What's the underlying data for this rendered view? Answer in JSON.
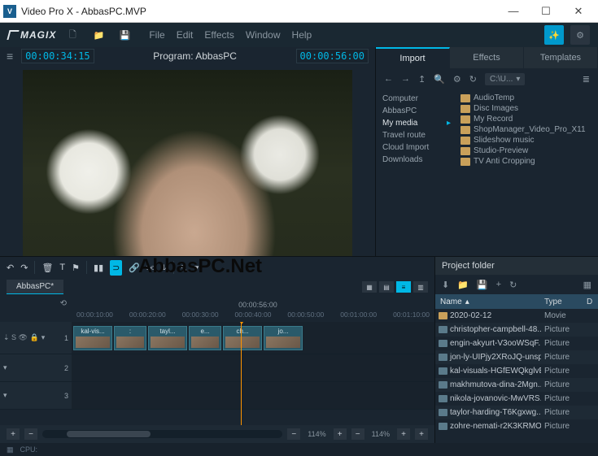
{
  "window": {
    "title": "Video Pro X - AbbasPC.MVP",
    "min": "—",
    "max": "☐",
    "close": "✕"
  },
  "brand": "MAGIX",
  "menu": {
    "file": "File",
    "edit": "Edit",
    "effects": "Effects",
    "window": "Window",
    "help": "Help"
  },
  "preview": {
    "tc_in": "00:00:34:15",
    "program": "Program: AbbasPC",
    "tc_out": "00:00:56:00",
    "ruler_tc": "56:00"
  },
  "import_tabs": {
    "import": "Import",
    "effects": "Effects",
    "templates": "Templates"
  },
  "browser": {
    "path": "C:\\U...",
    "refresh": "↻",
    "tree": {
      "computer": "Computer",
      "abbaspc": "AbbasPC",
      "mymedia": "My media",
      "travel": "Travel route",
      "cloud": "Cloud Import",
      "downloads": "Downloads"
    },
    "folders": {
      "f1": "AudioTemp",
      "f2": "Disc Images",
      "f3": "My Record",
      "f4": "ShopManager_Video_Pro_X11",
      "f5": "Slideshow music",
      "f6": "Studio-Preview",
      "f7": "TV Anti Cropping"
    }
  },
  "timeline": {
    "tab": "AbbasPC*",
    "ruler_center": "00:00:56:00",
    "timestamps": {
      "t1": "00:00:10:00",
      "t2": "00:00:20:00",
      "t3": "00:00:30:00",
      "t4": "00:00:40:00",
      "t5": "00:00:50:00",
      "t6": "00:01:00:00",
      "t7": "00:01:10:00"
    },
    "clips": {
      "c1": "kal-vis...",
      "c2": ":",
      "c3": "tayl...",
      "c4": "e...",
      "c5": "ch...",
      "c6": "jo..."
    },
    "track_controls": "⇣ S 👁 🔒",
    "zoom1": "114%",
    "zoom2": "114%"
  },
  "project": {
    "title": "Project folder",
    "col_name": "Name",
    "col_type": "Type",
    "col_d": "D",
    "rows": {
      "r0": {
        "name": "2020-02-12",
        "type": "Movie",
        "icon": "f"
      },
      "r1": {
        "name": "christopher-campbell-48...",
        "type": "Picture",
        "icon": "p"
      },
      "r2": {
        "name": "engin-akyurt-V3ooWSqF...",
        "type": "Picture",
        "icon": "p"
      },
      "r3": {
        "name": "jon-ly-UIPjy2XRoJQ-unspl...",
        "type": "Picture",
        "icon": "p"
      },
      "r4": {
        "name": "kal-visuals-HGfEWQkglvE...",
        "type": "Picture",
        "icon": "p"
      },
      "r5": {
        "name": "makhmutova-dina-2Mgn...",
        "type": "Picture",
        "icon": "p"
      },
      "r6": {
        "name": "nikola-jovanovic-MwVRS...",
        "type": "Picture",
        "icon": "p"
      },
      "r7": {
        "name": "taylor-harding-T6Kgxwg...",
        "type": "Picture",
        "icon": "p"
      },
      "r8": {
        "name": "zohre-nemati-r2K3KRMO...",
        "type": "Picture",
        "icon": "p"
      }
    }
  },
  "status": {
    "cpu": "CPU: "
  },
  "watermark": "AbbasPC.Net"
}
